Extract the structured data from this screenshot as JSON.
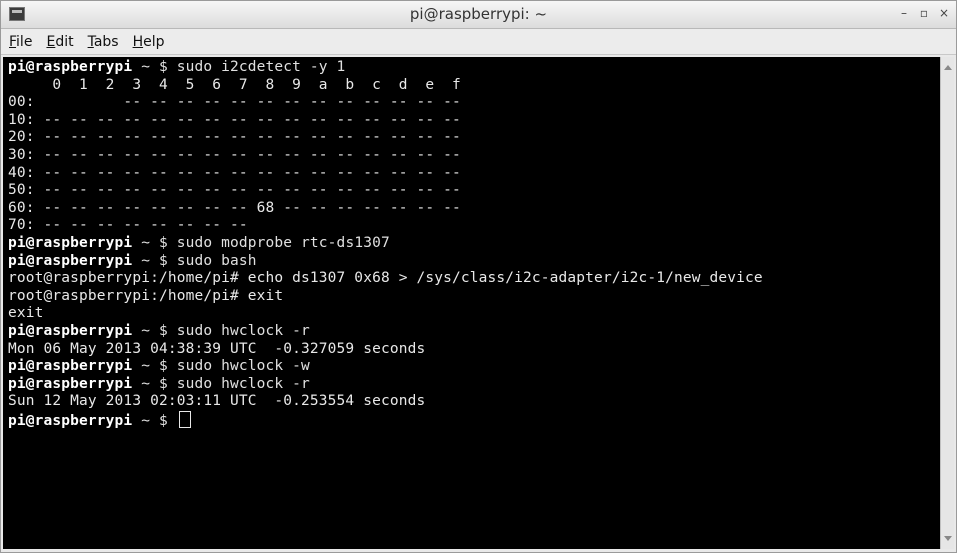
{
  "window": {
    "title": "pi@raspberrypi: ~",
    "controls": {
      "minimize": "–",
      "maximize": "▫",
      "close": "×"
    }
  },
  "menu": [
    {
      "label": "File",
      "mnemonic": "F"
    },
    {
      "label": "Edit",
      "mnemonic": "E"
    },
    {
      "label": "Tabs",
      "mnemonic": "T"
    },
    {
      "label": "Help",
      "mnemonic": "H"
    }
  ],
  "terminal": {
    "lines": [
      {
        "prompt": "pi@raspberrypi",
        "rest": " ~ $ sudo i2cdetect -y 1"
      },
      {
        "text": "     0  1  2  3  4  5  6  7  8  9  a  b  c  d  e  f"
      },
      {
        "text": "00:          -- -- -- -- -- -- -- -- -- -- -- -- --"
      },
      {
        "text": "10: -- -- -- -- -- -- -- -- -- -- -- -- -- -- -- --"
      },
      {
        "text": "20: -- -- -- -- -- -- -- -- -- -- -- -- -- -- -- --"
      },
      {
        "text": "30: -- -- -- -- -- -- -- -- -- -- -- -- -- -- -- --"
      },
      {
        "text": "40: -- -- -- -- -- -- -- -- -- -- -- -- -- -- -- --"
      },
      {
        "text": "50: -- -- -- -- -- -- -- -- -- -- -- -- -- -- -- --"
      },
      {
        "text": "60: -- -- -- -- -- -- -- -- 68 -- -- -- -- -- -- --"
      },
      {
        "text": "70: -- -- -- -- -- -- -- --"
      },
      {
        "prompt": "pi@raspberrypi",
        "rest": " ~ $ sudo modprobe rtc-ds1307"
      },
      {
        "prompt": "pi@raspberrypi",
        "rest": " ~ $ sudo bash"
      },
      {
        "text": "root@raspberrypi:/home/pi# echo ds1307 0x68 > /sys/class/i2c-adapter/i2c-1/new_device"
      },
      {
        "text": "root@raspberrypi:/home/pi# exit"
      },
      {
        "text": "exit"
      },
      {
        "prompt": "pi@raspberrypi",
        "rest": " ~ $ sudo hwclock -r"
      },
      {
        "text": "Mon 06 May 2013 04:38:39 UTC  -0.327059 seconds"
      },
      {
        "prompt": "pi@raspberrypi",
        "rest": " ~ $ sudo hwclock -w"
      },
      {
        "prompt": "pi@raspberrypi",
        "rest": " ~ $ sudo hwclock -r"
      },
      {
        "text": "Sun 12 May 2013 02:03:11 UTC  -0.253554 seconds"
      },
      {
        "prompt": "pi@raspberrypi",
        "rest": " ~ $ ",
        "cursor": true
      }
    ]
  }
}
